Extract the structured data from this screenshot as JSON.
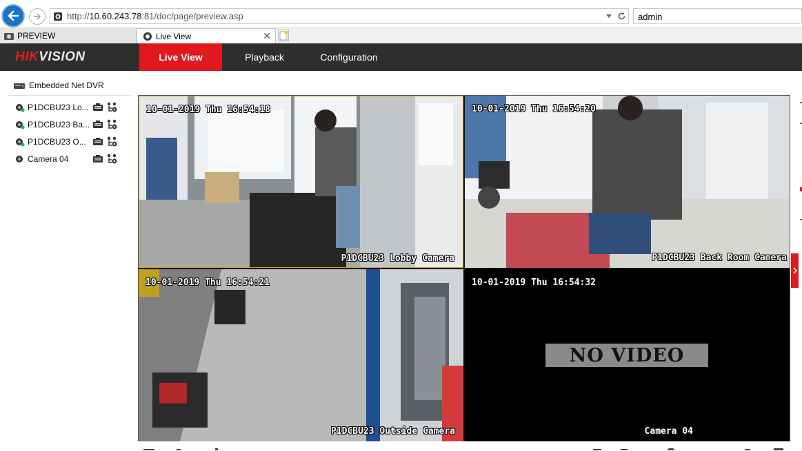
{
  "browser": {
    "url_dim_prefix": "http://",
    "url_host": "10.60.243.78",
    "url_rest": ":81/doc/page/preview.asp",
    "search_value": "admin",
    "tabs": [
      {
        "label": "PREVIEW"
      },
      {
        "label": "Live View"
      }
    ]
  },
  "app": {
    "logo_red": "HIK",
    "logo_white": "VISION",
    "nav": {
      "live_view": "Live View",
      "playback": "Playback",
      "configuration": "Configuration"
    },
    "accent_color": "#e0191e"
  },
  "sidebar": {
    "device": "Embedded Net DVR",
    "cameras": [
      {
        "label": "P1DCBU23 Lo..."
      },
      {
        "label": "P1DCBU23 Ba..."
      },
      {
        "label": "P1DCBU23 O..."
      },
      {
        "label": "Camera 04"
      }
    ]
  },
  "panes": [
    {
      "timestamp": "10-01-2019 Thu 16:54:18",
      "name": "P1DCBU23 Lobby Camera"
    },
    {
      "timestamp": "10-01-2019 Thu 16:54:20",
      "name": "P1DCBU23 Back Room Camera"
    },
    {
      "timestamp": "10-01-2019 Thu 16:54:21",
      "name": "P1DCBU23 Outside Camera"
    },
    {
      "timestamp": "10-01-2019 Thu 16:54:32",
      "name": "Camera 04",
      "status": "NO VIDEO"
    }
  ]
}
